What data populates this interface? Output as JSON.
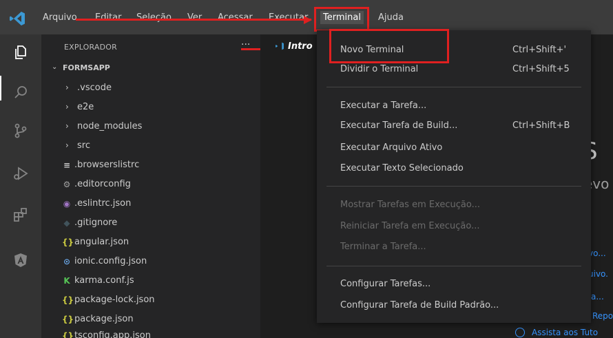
{
  "menubar": {
    "items": [
      "Arquivo",
      "Editar",
      "Seleção",
      "Ver",
      "Acessar",
      "Executar",
      "Terminal",
      "Ajuda"
    ]
  },
  "sidebar": {
    "title": "EXPLORADOR",
    "more": "···",
    "section": "FORMSAPP",
    "items": [
      {
        "label": ".vscode",
        "type": "folder"
      },
      {
        "label": "e2e",
        "type": "folder"
      },
      {
        "label": "node_modules",
        "type": "folder"
      },
      {
        "label": "src",
        "type": "folder"
      },
      {
        "label": ".browserslistrc",
        "type": "file",
        "icon": "≡"
      },
      {
        "label": ".editorconfig",
        "type": "file",
        "icon": "⚙"
      },
      {
        "label": ".eslintrc.json",
        "type": "file",
        "icon": "◉"
      },
      {
        "label": ".gitignore",
        "type": "file",
        "icon": "◆"
      },
      {
        "label": "angular.json",
        "type": "file",
        "icon": "{}"
      },
      {
        "label": "ionic.config.json",
        "type": "file",
        "icon": "⊙"
      },
      {
        "label": "karma.conf.js",
        "type": "file",
        "icon": "K"
      },
      {
        "label": "package-lock.json",
        "type": "file",
        "icon": "{}"
      },
      {
        "label": "package.json",
        "type": "file",
        "icon": "{}"
      },
      {
        "label": "tsconfig.app.json",
        "type": "file",
        "icon": "{}"
      }
    ]
  },
  "editor": {
    "tab_label": "Intro",
    "big_text": "S",
    "sub_text": "evo",
    "links": [
      "vo...",
      "uivo.",
      "a...",
      "Repo",
      "Assista aos Tuto"
    ]
  },
  "terminal_menu": {
    "items": [
      {
        "label": "Novo Terminal",
        "shortcut": "Ctrl+Shift+'"
      },
      {
        "label": "Dividir o Terminal",
        "shortcut": "Ctrl+Shift+5"
      },
      {
        "label": "Executar a Tarefa...",
        "shortcut": ""
      },
      {
        "label": "Executar Tarefa de Build...",
        "shortcut": "Ctrl+Shift+B"
      },
      {
        "label": "Executar Arquivo Ativo",
        "shortcut": ""
      },
      {
        "label": "Executar Texto Selecionado",
        "shortcut": ""
      },
      {
        "label": "Mostrar Tarefas em Execução...",
        "shortcut": ""
      },
      {
        "label": "Reiniciar Tarefa em Execução...",
        "shortcut": ""
      },
      {
        "label": "Terminar a Tarefa...",
        "shortcut": ""
      },
      {
        "label": "Configurar Tarefas...",
        "shortcut": ""
      },
      {
        "label": "Configurar Tarefa de Build Padrão...",
        "shortcut": ""
      }
    ]
  },
  "colors": {
    "annotation_red": "#e02020",
    "vscode_blue": "#3c99d4",
    "link_blue": "#3794ff"
  }
}
